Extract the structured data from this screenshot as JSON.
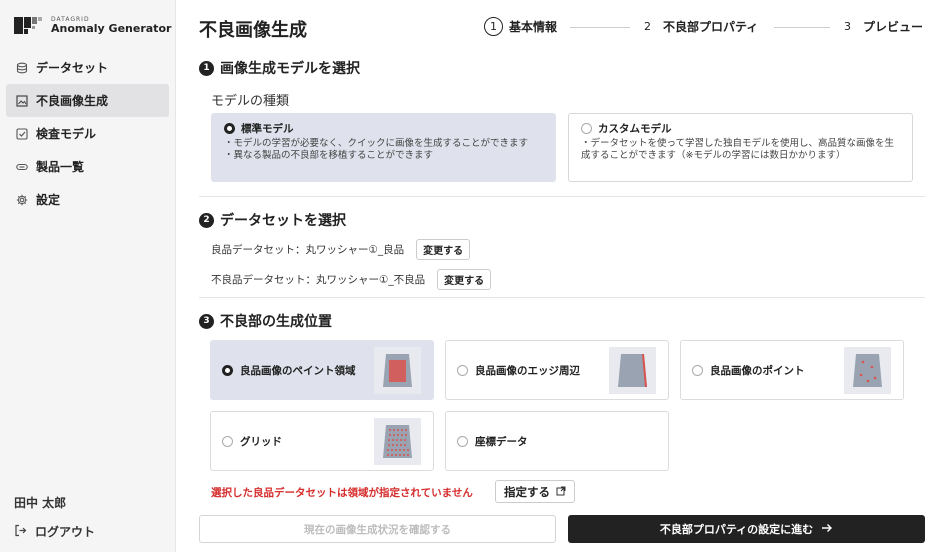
{
  "brand": {
    "small": "DATAGRID",
    "name": "Anomaly Generator"
  },
  "nav": [
    {
      "label": "データセット",
      "icon": "database-icon",
      "active": false
    },
    {
      "label": "不良画像生成",
      "icon": "image-icon",
      "active": true
    },
    {
      "label": "検査モデル",
      "icon": "checkbox-icon",
      "active": false
    },
    {
      "label": "製品一覧",
      "icon": "link-icon",
      "active": false
    },
    {
      "label": "設定",
      "icon": "gear-icon",
      "active": false
    }
  ],
  "user": {
    "name": "田中 太郎",
    "logout": "ログアウト"
  },
  "page": {
    "title": "不良画像生成"
  },
  "steps": [
    {
      "num": "1",
      "label": "基本情報"
    },
    {
      "num": "2",
      "label": "不良部プロパティ"
    },
    {
      "num": "3",
      "label": "プレビュー"
    }
  ],
  "section1": {
    "num": "1",
    "title": "画像生成モデルを選択",
    "sub_label": "モデルの種類",
    "options": [
      {
        "title": "標準モデル",
        "desc": "・モデルの学習が必要なく、クイックに画像を生成することができます\n・異なる製品の不良部を移植することができます",
        "selected": true
      },
      {
        "title": "カスタムモデル",
        "desc": "・データセットを使って学習した独自モデルを使用し、高品質な画像を生成することができます（※モデルの学習には数日かかります）",
        "selected": false
      }
    ]
  },
  "section2": {
    "num": "2",
    "title": "データセットを選択",
    "good_dataset": "良品データセット：丸ワッシャー①_良品",
    "bad_dataset": "不良品データセット：丸ワッシャー①_不良品",
    "change_label": "変更する"
  },
  "section3": {
    "num": "3",
    "title": "不良部の生成位置",
    "options": [
      {
        "label": "良品画像のペイント領域",
        "selected": true,
        "thumb": "paint"
      },
      {
        "label": "良品画像のエッジ周辺",
        "selected": false,
        "thumb": "edge"
      },
      {
        "label": "良品画像のポイント",
        "selected": false,
        "thumb": "point"
      },
      {
        "label": "グリッド",
        "selected": false,
        "thumb": "grid"
      },
      {
        "label": "座標データ",
        "selected": false,
        "thumb": "none"
      }
    ],
    "warning": "選択した良品データセットは領域が指定されていません",
    "specify_label": "指定する"
  },
  "footer": {
    "check_label": "現在の画像生成状況を確認する",
    "next_label": "不良部プロパティの設定に進む"
  },
  "colors": {
    "accent": "#222222",
    "selected_bg": "#dfe2ec",
    "warning": "#d62d2d",
    "thumb_red": "#d9534f",
    "thumb_shape": "#9aa3b2"
  }
}
